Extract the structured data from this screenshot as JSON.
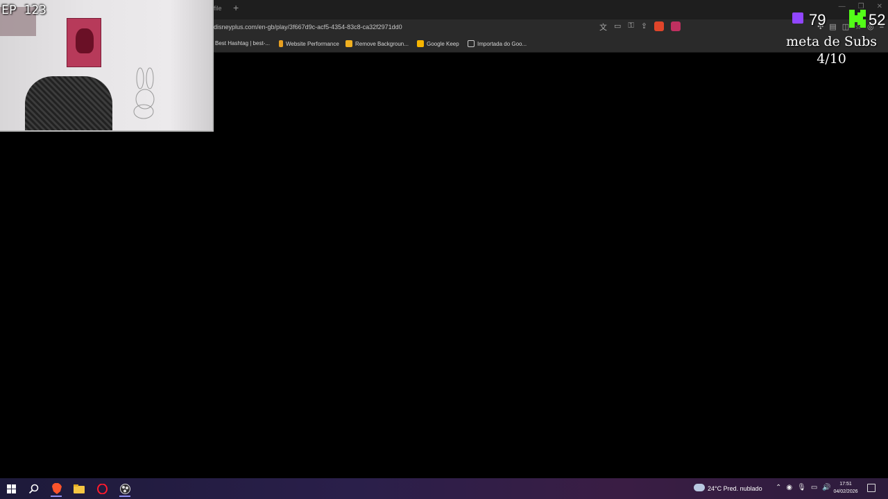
{
  "browser": {
    "tab_stub": "file",
    "new_tab": "+",
    "url": "disneyplus.com/en-gb/play/3f667d9c-acf5-4354-83c8-ca32f2971dd0",
    "window_controls": [
      "—",
      "❐",
      "✕"
    ],
    "bookmarks": [
      {
        "label": "Best Hashtag | best-...",
        "icon": "hashtag-icon",
        "color": "#3a3a3a"
      },
      {
        "label": "Website Performance",
        "icon": "rocket-icon",
        "color": "#e8a020"
      },
      {
        "label": "Remove Backgroun...",
        "icon": "removebg-icon",
        "color": "#f0b020"
      },
      {
        "label": "Google Keep",
        "icon": "keep-icon",
        "color": "#f7b500"
      },
      {
        "label": "Importada do Goo...",
        "icon": "folder-icon",
        "color": "#cccccc"
      }
    ]
  },
  "overlay": {
    "episode": "EP 123",
    "twitch_count": "79",
    "kick_count": "52",
    "subs_goal_title": "meta de Subs",
    "subs_goal_progress": "4/10",
    "colors": {
      "twitch": "#9146ff",
      "kick": "#53fc18"
    }
  },
  "taskbar": {
    "apps": [
      "windows-start-icon",
      "search-icon",
      "brave-icon",
      "file-explorer-icon",
      "opera-icon",
      "obs-icon"
    ],
    "weather": "24°C  Pred. nublado",
    "time": "17:51",
    "date": "04/02/2026"
  }
}
